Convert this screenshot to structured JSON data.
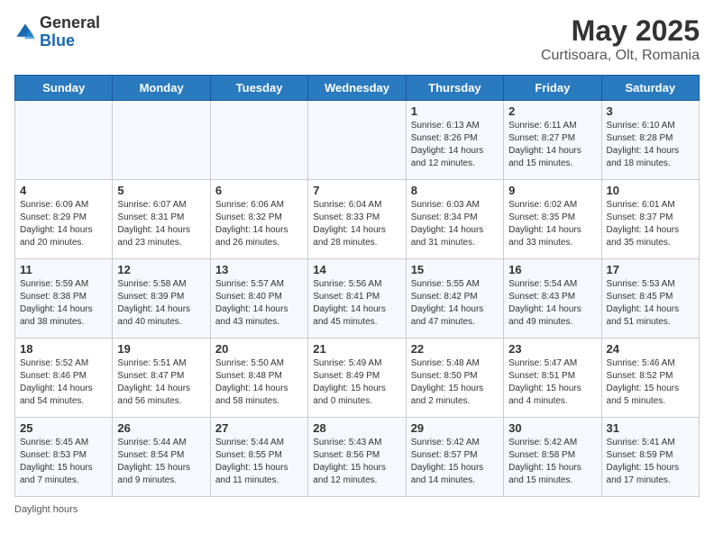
{
  "header": {
    "logo_general": "General",
    "logo_blue": "Blue",
    "month": "May 2025",
    "location": "Curtisoara, Olt, Romania"
  },
  "days_of_week": [
    "Sunday",
    "Monday",
    "Tuesday",
    "Wednesday",
    "Thursday",
    "Friday",
    "Saturday"
  ],
  "weeks": [
    [
      {
        "day": "",
        "info": ""
      },
      {
        "day": "",
        "info": ""
      },
      {
        "day": "",
        "info": ""
      },
      {
        "day": "",
        "info": ""
      },
      {
        "day": "1",
        "info": "Sunrise: 6:13 AM\nSunset: 8:26 PM\nDaylight: 14 hours and 12 minutes."
      },
      {
        "day": "2",
        "info": "Sunrise: 6:11 AM\nSunset: 8:27 PM\nDaylight: 14 hours and 15 minutes."
      },
      {
        "day": "3",
        "info": "Sunrise: 6:10 AM\nSunset: 8:28 PM\nDaylight: 14 hours and 18 minutes."
      }
    ],
    [
      {
        "day": "4",
        "info": "Sunrise: 6:09 AM\nSunset: 8:29 PM\nDaylight: 14 hours and 20 minutes."
      },
      {
        "day": "5",
        "info": "Sunrise: 6:07 AM\nSunset: 8:31 PM\nDaylight: 14 hours and 23 minutes."
      },
      {
        "day": "6",
        "info": "Sunrise: 6:06 AM\nSunset: 8:32 PM\nDaylight: 14 hours and 26 minutes."
      },
      {
        "day": "7",
        "info": "Sunrise: 6:04 AM\nSunset: 8:33 PM\nDaylight: 14 hours and 28 minutes."
      },
      {
        "day": "8",
        "info": "Sunrise: 6:03 AM\nSunset: 8:34 PM\nDaylight: 14 hours and 31 minutes."
      },
      {
        "day": "9",
        "info": "Sunrise: 6:02 AM\nSunset: 8:35 PM\nDaylight: 14 hours and 33 minutes."
      },
      {
        "day": "10",
        "info": "Sunrise: 6:01 AM\nSunset: 8:37 PM\nDaylight: 14 hours and 35 minutes."
      }
    ],
    [
      {
        "day": "11",
        "info": "Sunrise: 5:59 AM\nSunset: 8:38 PM\nDaylight: 14 hours and 38 minutes."
      },
      {
        "day": "12",
        "info": "Sunrise: 5:58 AM\nSunset: 8:39 PM\nDaylight: 14 hours and 40 minutes."
      },
      {
        "day": "13",
        "info": "Sunrise: 5:57 AM\nSunset: 8:40 PM\nDaylight: 14 hours and 43 minutes."
      },
      {
        "day": "14",
        "info": "Sunrise: 5:56 AM\nSunset: 8:41 PM\nDaylight: 14 hours and 45 minutes."
      },
      {
        "day": "15",
        "info": "Sunrise: 5:55 AM\nSunset: 8:42 PM\nDaylight: 14 hours and 47 minutes."
      },
      {
        "day": "16",
        "info": "Sunrise: 5:54 AM\nSunset: 8:43 PM\nDaylight: 14 hours and 49 minutes."
      },
      {
        "day": "17",
        "info": "Sunrise: 5:53 AM\nSunset: 8:45 PM\nDaylight: 14 hours and 51 minutes."
      }
    ],
    [
      {
        "day": "18",
        "info": "Sunrise: 5:52 AM\nSunset: 8:46 PM\nDaylight: 14 hours and 54 minutes."
      },
      {
        "day": "19",
        "info": "Sunrise: 5:51 AM\nSunset: 8:47 PM\nDaylight: 14 hours and 56 minutes."
      },
      {
        "day": "20",
        "info": "Sunrise: 5:50 AM\nSunset: 8:48 PM\nDaylight: 14 hours and 58 minutes."
      },
      {
        "day": "21",
        "info": "Sunrise: 5:49 AM\nSunset: 8:49 PM\nDaylight: 15 hours and 0 minutes."
      },
      {
        "day": "22",
        "info": "Sunrise: 5:48 AM\nSunset: 8:50 PM\nDaylight: 15 hours and 2 minutes."
      },
      {
        "day": "23",
        "info": "Sunrise: 5:47 AM\nSunset: 8:51 PM\nDaylight: 15 hours and 4 minutes."
      },
      {
        "day": "24",
        "info": "Sunrise: 5:46 AM\nSunset: 8:52 PM\nDaylight: 15 hours and 5 minutes."
      }
    ],
    [
      {
        "day": "25",
        "info": "Sunrise: 5:45 AM\nSunset: 8:53 PM\nDaylight: 15 hours and 7 minutes."
      },
      {
        "day": "26",
        "info": "Sunrise: 5:44 AM\nSunset: 8:54 PM\nDaylight: 15 hours and 9 minutes."
      },
      {
        "day": "27",
        "info": "Sunrise: 5:44 AM\nSunset: 8:55 PM\nDaylight: 15 hours and 11 minutes."
      },
      {
        "day": "28",
        "info": "Sunrise: 5:43 AM\nSunset: 8:56 PM\nDaylight: 15 hours and 12 minutes."
      },
      {
        "day": "29",
        "info": "Sunrise: 5:42 AM\nSunset: 8:57 PM\nDaylight: 15 hours and 14 minutes."
      },
      {
        "day": "30",
        "info": "Sunrise: 5:42 AM\nSunset: 8:58 PM\nDaylight: 15 hours and 15 minutes."
      },
      {
        "day": "31",
        "info": "Sunrise: 5:41 AM\nSunset: 8:59 PM\nDaylight: 15 hours and 17 minutes."
      }
    ]
  ],
  "footer": {
    "note": "Daylight hours"
  }
}
